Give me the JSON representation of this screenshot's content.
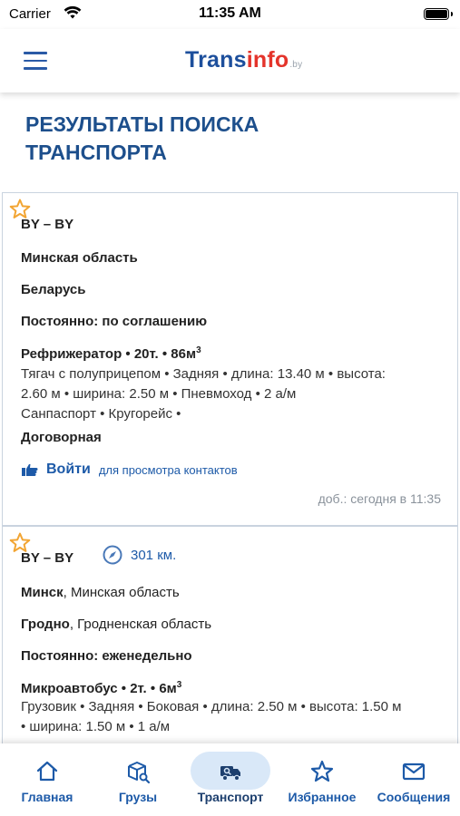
{
  "status_bar": {
    "carrier": "Carrier",
    "time": "11:35 AM"
  },
  "header": {
    "logo_trans": "Trans",
    "logo_info": "info",
    "logo_by": ".by"
  },
  "page": {
    "title": "РЕЗУЛЬТАТЫ ПОИСКА ТРАНСПОРТА"
  },
  "results": [
    {
      "route": "BY – BY",
      "from_region": "Минская область",
      "to_country": "Беларусь",
      "schedule_label": "Постоянно",
      "schedule_value": "по соглашению",
      "vehicle": "Рефрижератор • 20т. • 86м",
      "vehicle_sup": "3",
      "details_1": "Тягач с полуприцепом • Задняя • длина: 13.40 м • высота:",
      "details_2": "2.60 м • ширина: 2.50 м • Пневмоход • 2 а/м",
      "details_3": "Санпаспорт • Кругорейс  •",
      "price": "Договорная",
      "login_link": "Войти",
      "login_hint": "для просмотра контактов",
      "added": "доб.: сегодня в 11:35"
    },
    {
      "route": "BY – BY",
      "distance": "301 км.",
      "from_city": "Минск",
      "from_region": ", Минская область",
      "to_city": "Гродно",
      "to_region": ", Гродненская область",
      "schedule_label": "Постоянно",
      "schedule_value": "еженедельно",
      "vehicle": "Микроавтобус • 2т. • 6м",
      "vehicle_sup": "3",
      "details_1": "Грузовик • Задняя • Боковая • длина: 2.50 м • высота: 1.50 м",
      "details_2": "• ширина: 1.50 м • 1 а/м"
    }
  ],
  "tabs": [
    {
      "label": "Главная",
      "icon": "home-icon"
    },
    {
      "label": "Грузы",
      "icon": "cargo-search-icon"
    },
    {
      "label": "Транспорт",
      "icon": "truck-search-icon",
      "active": true
    },
    {
      "label": "Избранное",
      "icon": "star-icon"
    },
    {
      "label": "Сообщения",
      "icon": "envelope-icon"
    }
  ],
  "colors": {
    "accent": "#1d5aa8",
    "title": "#1d4f8c",
    "logo_red": "#e4342b",
    "star": "#f2a533",
    "active_tab_bg": "#d9e8f8"
  }
}
